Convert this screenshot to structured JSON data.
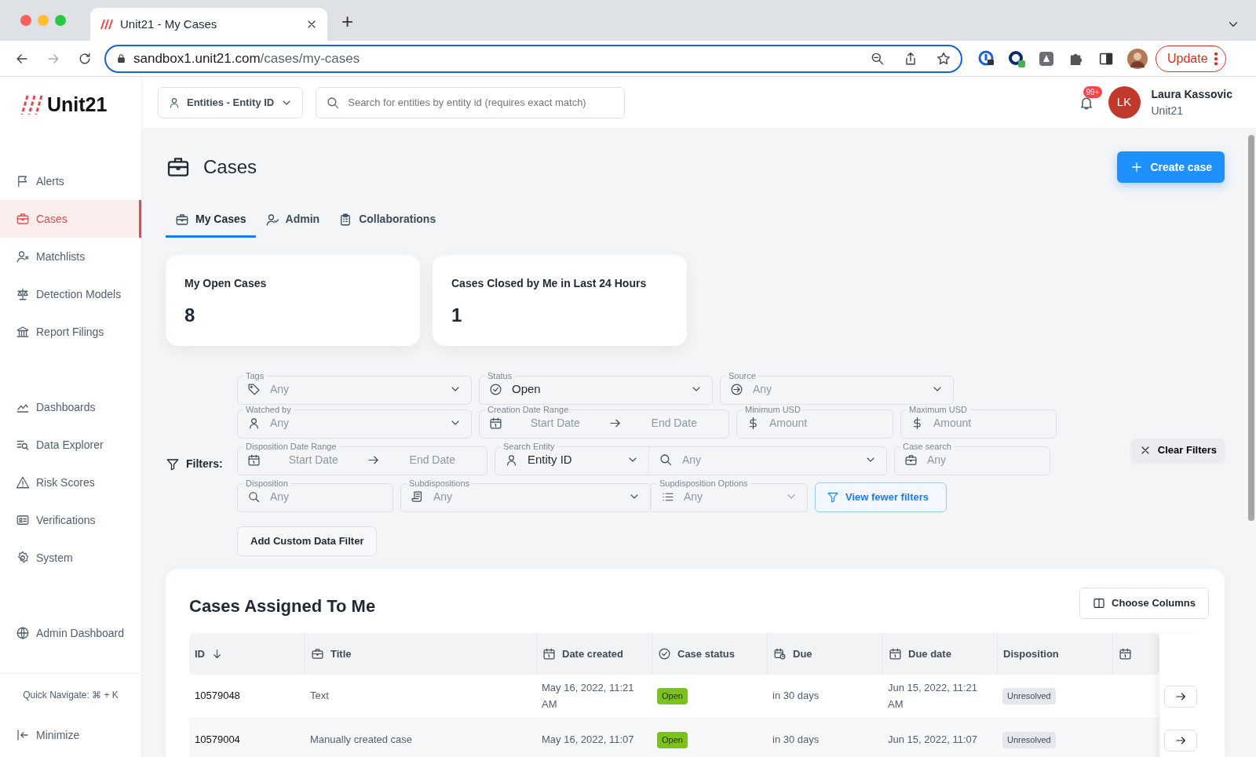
{
  "browser": {
    "tab_title": "Unit21 - My Cases",
    "new_tab": "+",
    "url_host": "sandbox1.unit21.com",
    "url_path": "/cases/my-cases",
    "update_button": "Update"
  },
  "header": {
    "logo": "Unit21",
    "entity_select": "Entities - Entity ID",
    "search_placeholder": "Search for entities by entity id (requires exact match)",
    "notification_count": "99+",
    "user_initials": "LK",
    "user_name": "Laura Kassovic",
    "user_org": "Unit21"
  },
  "sidebar": {
    "groups": [
      [
        {
          "label": "Alerts",
          "selected": false
        },
        {
          "label": "Cases",
          "selected": true
        },
        {
          "label": "Matchlists",
          "selected": false
        },
        {
          "label": "Detection Models",
          "selected": false
        },
        {
          "label": "Report Filings",
          "selected": false
        }
      ],
      [
        {
          "label": "Dashboards",
          "selected": false
        },
        {
          "label": "Data Explorer",
          "selected": false
        },
        {
          "label": "Risk Scores",
          "selected": false
        },
        {
          "label": "Verifications",
          "selected": false
        },
        {
          "label": "System",
          "selected": false
        }
      ],
      [
        {
          "label": "Admin Dashboard",
          "selected": false
        }
      ]
    ],
    "quick_navigate": "Quick Navigate: ⌘ + K",
    "minimize": "Minimize"
  },
  "page": {
    "title": "Cases",
    "create_button": "Create case",
    "tabs": [
      {
        "label": "My Cases",
        "selected": true
      },
      {
        "label": "Admin",
        "selected": false
      },
      {
        "label": "Collaborations",
        "selected": false
      }
    ],
    "stats": [
      {
        "label": "My Open Cases",
        "value": "8"
      },
      {
        "label": "Cases Closed by Me in Last 24 Hours",
        "value": "1"
      }
    ]
  },
  "filters": {
    "label": "Filters:",
    "clear_button": "Clear Filters",
    "add_button": "Add Custom Data Filter",
    "rows": [
      [
        {
          "kind": "select",
          "label": "Tags",
          "placeholder": "Any",
          "joined": false
        },
        {
          "kind": "select",
          "label": "Status",
          "value": "Open",
          "joined": false
        },
        {
          "kind": "select",
          "label": "Source",
          "placeholder": "Any",
          "joined": false
        }
      ],
      [
        {
          "kind": "select",
          "label": "Watched by",
          "placeholder": "Any",
          "joined": false
        },
        {
          "kind": "date_range",
          "label": "Creation Date Range",
          "start_placeholder": "Start Date",
          "end_placeholder": "End Date",
          "joined": false
        },
        {
          "kind": "amount",
          "label": "Minimum USD",
          "placeholder": "Amount",
          "joined": false
        },
        {
          "kind": "amount",
          "label": "Maximum USD",
          "placeholder": "Amount",
          "joined": false
        }
      ],
      [
        {
          "kind": "date_range",
          "label": "Disposition Date Range",
          "start_placeholder": "Start Date",
          "end_placeholder": "End Date",
          "joined": false
        },
        {
          "kind": "entity_search",
          "label": "Search Entity",
          "value": "Entity ID",
          "placeholder": "Any",
          "joined": false
        },
        {
          "kind": "text",
          "label": "Case search",
          "placeholder": "Any",
          "joined": false
        }
      ],
      [
        {
          "kind": "text",
          "label": "Disposition",
          "placeholder": "Any",
          "joined": false
        },
        {
          "kind": "select",
          "label": "Subdispositions",
          "placeholder": "Any",
          "joined": false
        },
        {
          "kind": "select",
          "label": "Supdisposition Options",
          "placeholder": "Any",
          "joined": true
        },
        {
          "kind": "button",
          "label": "View fewer filters",
          "joined": false
        }
      ]
    ]
  },
  "table": {
    "title": "Cases Assigned To Me",
    "choose_columns": "Choose Columns",
    "columns": [
      "ID",
      "Title",
      "Date created",
      "Case status",
      "Due",
      "Due date",
      "Disposition"
    ],
    "rows": [
      {
        "id": "10579048",
        "title": "Text",
        "date_created": "May 16, 2022, 11:21 AM",
        "case_status": "Open",
        "due": "in 30 days",
        "due_date": "Jun 15, 2022, 11:21 AM",
        "disposition": "Unresolved"
      },
      {
        "id": "10579004",
        "title": "Manually created case",
        "date_created": "May 16, 2022, 11:07",
        "case_status": "Open",
        "due": "in 30 days",
        "due_date": "Jun 15, 2022, 11:07",
        "disposition": "Unresolved"
      }
    ]
  }
}
